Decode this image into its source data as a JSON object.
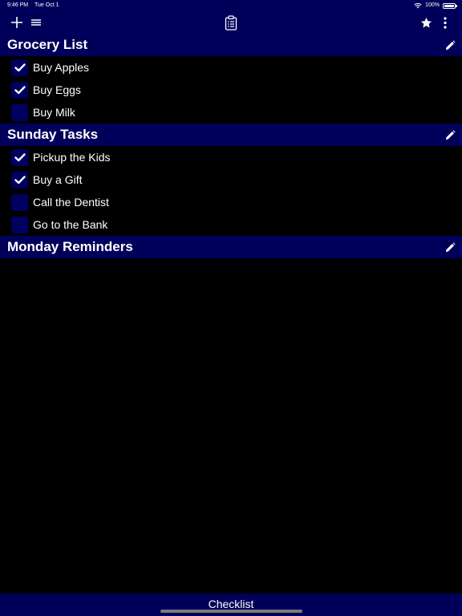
{
  "status_bar": {
    "time": "9:46 PM",
    "date": "Tue Oct 1",
    "battery": "100%"
  },
  "toolbar": {
    "add_icon": "plus-icon",
    "menu_icon": "hamburger-icon",
    "center_icon": "clipboard-list-icon",
    "favorite_icon": "star-icon",
    "more_icon": "more-vertical-icon"
  },
  "lists": [
    {
      "title": "Grocery List",
      "items": [
        {
          "label": "Buy Apples",
          "checked": true
        },
        {
          "label": "Buy Eggs",
          "checked": true
        },
        {
          "label": "Buy Milk",
          "checked": false
        }
      ]
    },
    {
      "title": "Sunday Tasks",
      "items": [
        {
          "label": "Pickup the Kids",
          "checked": true
        },
        {
          "label": "Buy a Gift",
          "checked": true
        },
        {
          "label": "Call the Dentist",
          "checked": false
        },
        {
          "label": "Go to the Bank",
          "checked": false
        }
      ]
    },
    {
      "title": "Monday Reminders",
      "items": []
    }
  ],
  "bottom_bar": {
    "label": "Checklist"
  },
  "colors": {
    "header_bg": "#00005a",
    "checkbox_bg": "#000060",
    "background": "#000000",
    "text": "#ffffff"
  }
}
